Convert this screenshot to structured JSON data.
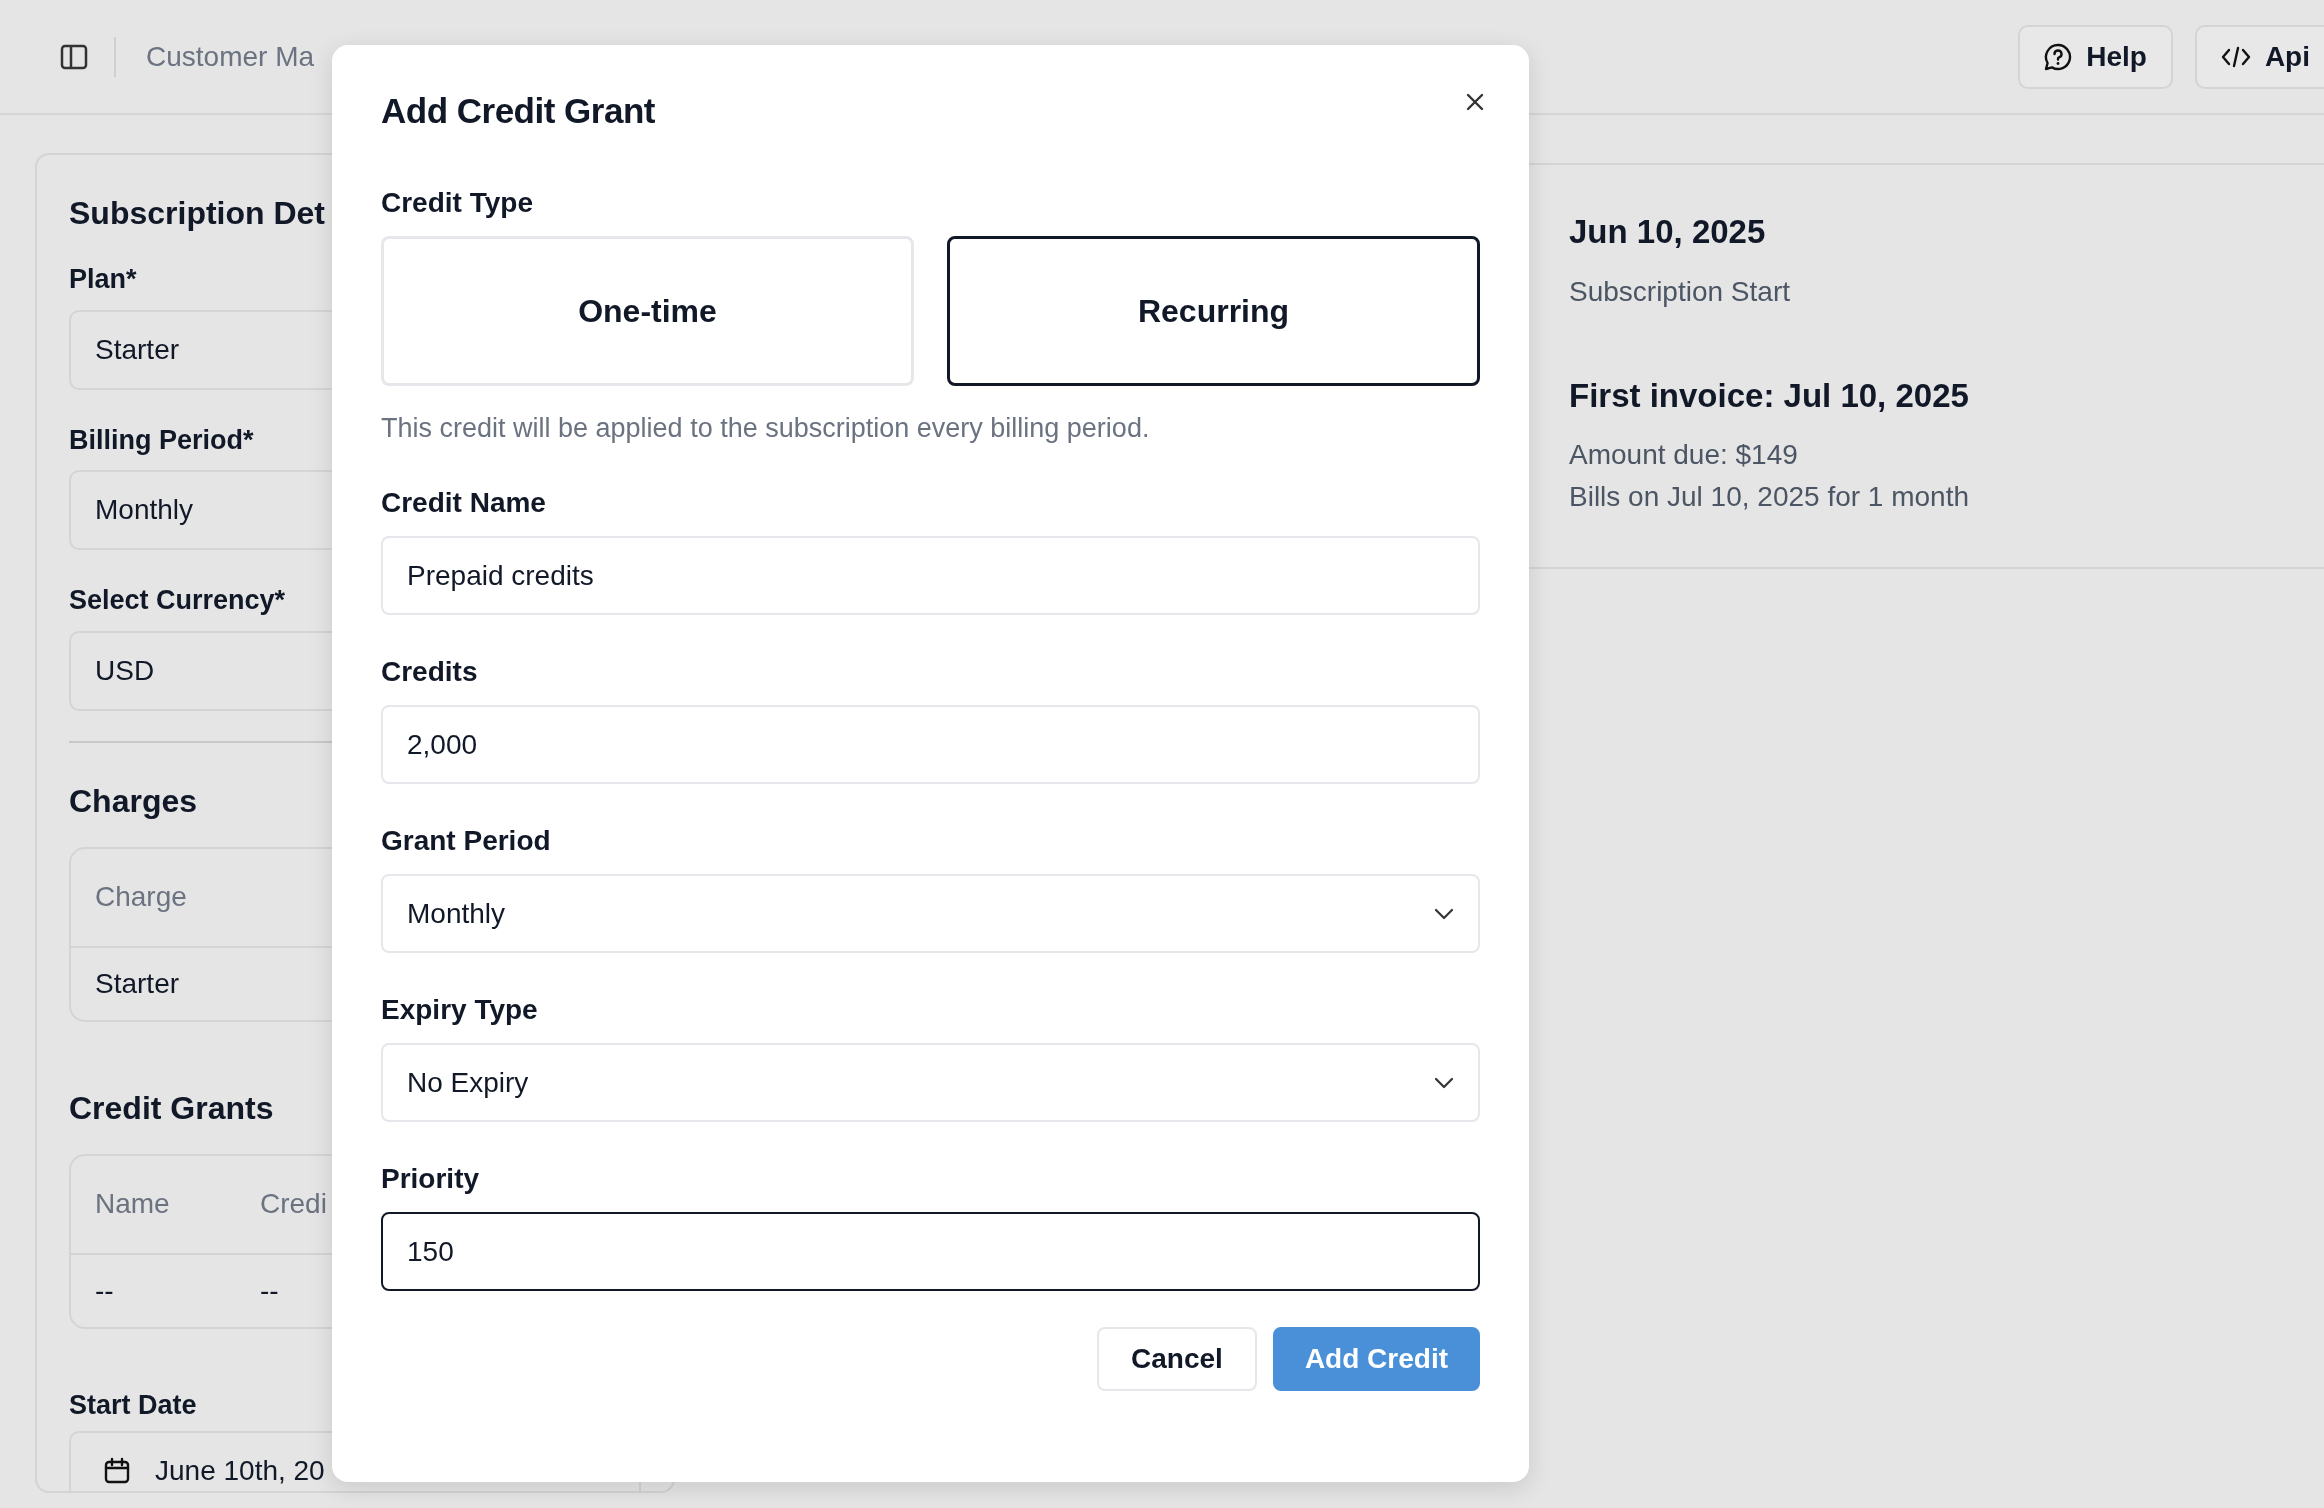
{
  "header": {
    "breadcrumb": [
      "Customer Ma"
    ],
    "buttons": [
      {
        "label": "Help",
        "kind": "help"
      },
      {
        "label": "Api",
        "kind": "api"
      }
    ]
  },
  "subscription": {
    "title": "Subscription Det",
    "fields": [
      {
        "label": "Plan*",
        "value": "Starter"
      },
      {
        "label": "Billing Period*",
        "value": "Monthly"
      },
      {
        "label": "Select Currency*",
        "value": "USD"
      }
    ],
    "charges": {
      "title": "Charges",
      "columns": [
        "Charge"
      ],
      "rows": [
        [
          "Starter"
        ]
      ]
    },
    "credit_grants": {
      "title": "Credit Grants",
      "columns": [
        "Name",
        "Credi"
      ],
      "rows": [
        [
          "--",
          "--"
        ]
      ]
    },
    "start_date": {
      "label": "Start Date",
      "value": "June 10th, 20"
    }
  },
  "timeline": [
    {
      "title": "Jun 10, 2025",
      "lines": [
        "Subscription Start"
      ]
    },
    {
      "title": "First invoice: Jul 10, 2025",
      "lines": [
        "Amount due: $149",
        "Bills on Jul 10, 2025 for 1 month"
      ]
    }
  ],
  "dialog": {
    "title": "Add Credit Grant",
    "credit_type": {
      "label": "Credit Type",
      "options": [
        {
          "label": "One-time",
          "selected": false
        },
        {
          "label": "Recurring",
          "selected": true
        }
      ],
      "help": "This credit will be applied to the subscription every billing period."
    },
    "fields": [
      {
        "kind": "input",
        "label": "Credit Name",
        "value": "Prepaid credits",
        "focused": false
      },
      {
        "kind": "input",
        "label": "Credits",
        "value": "2,000",
        "focused": false
      },
      {
        "kind": "select",
        "label": "Grant Period",
        "value": "Monthly",
        "focused": false
      },
      {
        "kind": "select",
        "label": "Expiry Type",
        "value": "No Expiry",
        "focused": false
      },
      {
        "kind": "input",
        "label": "Priority",
        "value": "150",
        "focused": true
      }
    ],
    "buttons": [
      {
        "label": "Cancel",
        "kind": "secondary"
      },
      {
        "label": "Add Credit",
        "kind": "primary"
      }
    ]
  }
}
